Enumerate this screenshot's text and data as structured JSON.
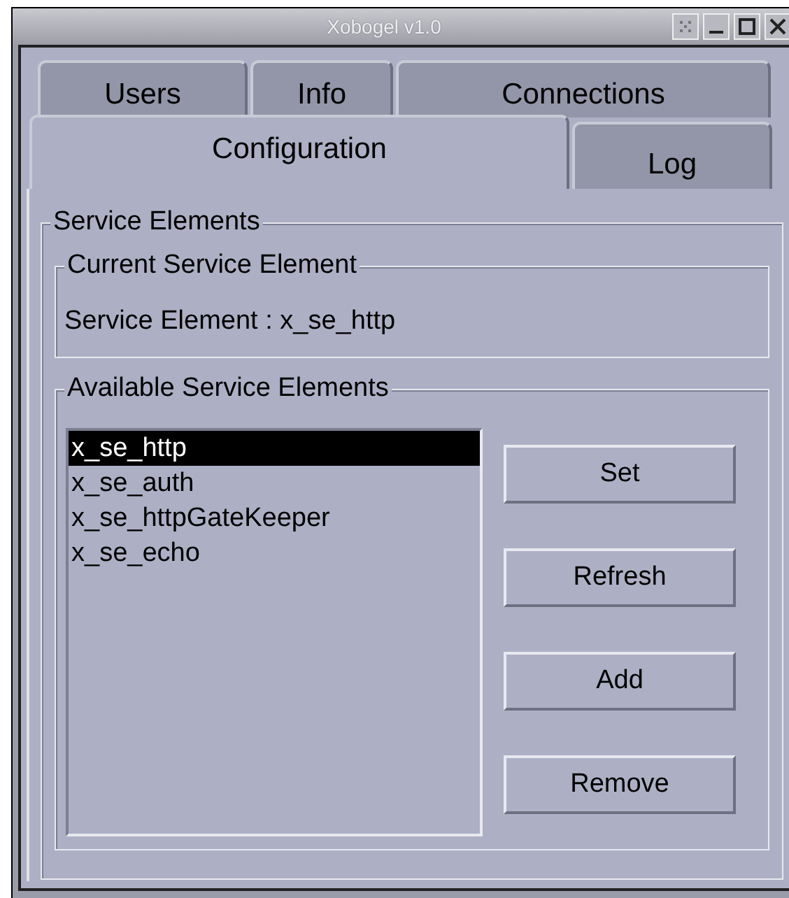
{
  "window": {
    "title": "Xobogel v1.0"
  },
  "tab_rows": [
    [
      {
        "label": "Users",
        "selected": false
      },
      {
        "label": "Info",
        "selected": false
      },
      {
        "label": "Connections",
        "selected": false
      }
    ],
    [
      {
        "label": "Configuration",
        "selected": true
      },
      {
        "label": "Log",
        "selected": false
      }
    ]
  ],
  "service_elements": {
    "title": "Service Elements",
    "current": {
      "title": "Current Service Element",
      "text": "Service Element : x_se_http"
    },
    "available": {
      "title": "Available Service Elements",
      "items": [
        {
          "label": "x_se_http",
          "selected": true
        },
        {
          "label": "x_se_auth",
          "selected": false
        },
        {
          "label": "x_se_httpGateKeeper",
          "selected": false
        },
        {
          "label": "x_se_echo",
          "selected": false
        }
      ],
      "buttons": [
        "Set",
        "Refresh",
        "Add",
        "Remove"
      ]
    }
  }
}
